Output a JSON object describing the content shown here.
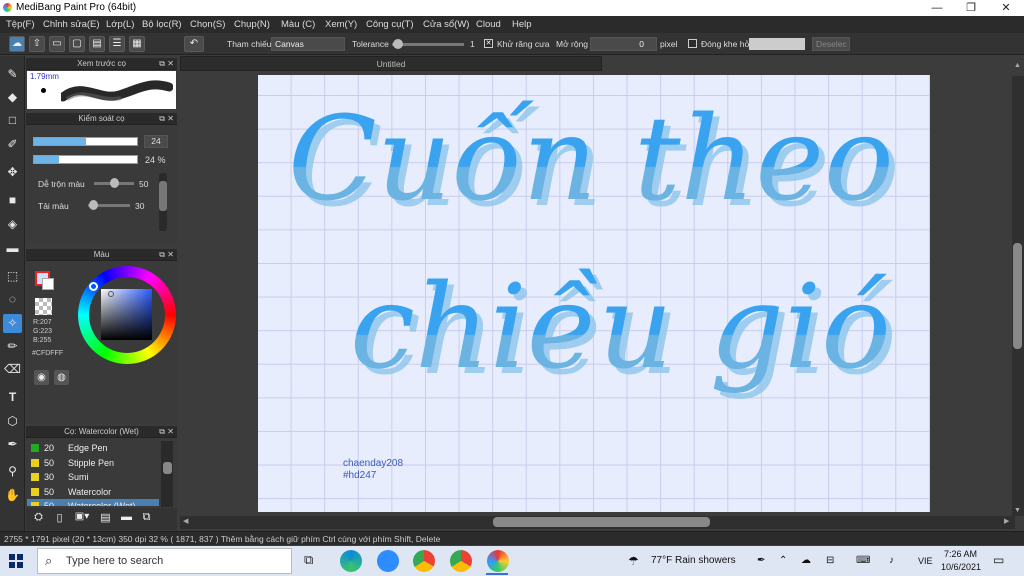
{
  "window": {
    "title": "MediBang Paint Pro (64bit)",
    "minimize": "—",
    "maximize": "❐",
    "close": "✕"
  },
  "menu": [
    "Tệp(F)",
    "Chỉnh sửa(E)",
    "Lớp(L)",
    "Bộ lọc(R)",
    "Chọn(S)",
    "Chụp(N)",
    "Màu (C)",
    "Xem(Y)",
    "Công cụ(T)",
    "Cửa sổ(W)",
    "Cloud",
    "Help"
  ],
  "toolbar": {
    "reference_label": "Tham chiếu",
    "reference_value": "Canvas",
    "tolerance_label": "Tolerance",
    "tolerance_value": "1",
    "antialias_label": "Khử răng cưa",
    "expand_label": "Mở rộng",
    "expand_value": "0",
    "expand_unit": "pixel",
    "close_gap_label": "Đóng khe hở",
    "deselect_label": "Deselec"
  },
  "brush_preview": {
    "title": "Xem trước cọ",
    "size": "1.79mm"
  },
  "brush_control": {
    "title": "Kiểm soát cọ",
    "size_value": "24",
    "size_fraction": 0.5,
    "opacity_value": "24 %",
    "opacity_fraction": 0.24,
    "blend_label": "Dễ trộn màu",
    "blend_value": "50",
    "reload_label": "Tải màu",
    "reload_value": "30"
  },
  "color_panel": {
    "title": "Màu",
    "r": "R:207",
    "g": "G:223",
    "b": "B:255",
    "hex": "#CFDFFF",
    "fg_color": "#CFDFFF"
  },
  "brush_list": {
    "title": "Cọ: Watercolor (Wet)",
    "items": [
      {
        "size": "20",
        "name": "Edge Pen",
        "color": "#22aa22"
      },
      {
        "size": "50",
        "name": "Stipple Pen",
        "color": "#e8d21d"
      },
      {
        "size": "30",
        "name": "Sumi",
        "color": "#e8d21d"
      },
      {
        "size": "50",
        "name": "Watercolor",
        "color": "#e8d21d"
      },
      {
        "size": "50",
        "name": "Watercolor (Wet)",
        "color": "#e8d21d"
      }
    ]
  },
  "document": {
    "tab": "Untitled",
    "artwork_line1": "Cuốn theo",
    "artwork_line2": "chiều gió",
    "credit_line1": "chaenday208",
    "credit_line2": "#hd247"
  },
  "status": "2755 * 1791 pixel   (20 * 13cm)   350 dpi   32 %   ( 1871, 837 )   Thêm bằng cách giữ phím Ctrl cùng với phím Shift, Delete",
  "taskbar": {
    "search_placeholder": "Type here to search",
    "weather": "77°F  Rain showers",
    "lang": "VIE",
    "time": "7:26 AM",
    "date": "10/6/2021"
  }
}
